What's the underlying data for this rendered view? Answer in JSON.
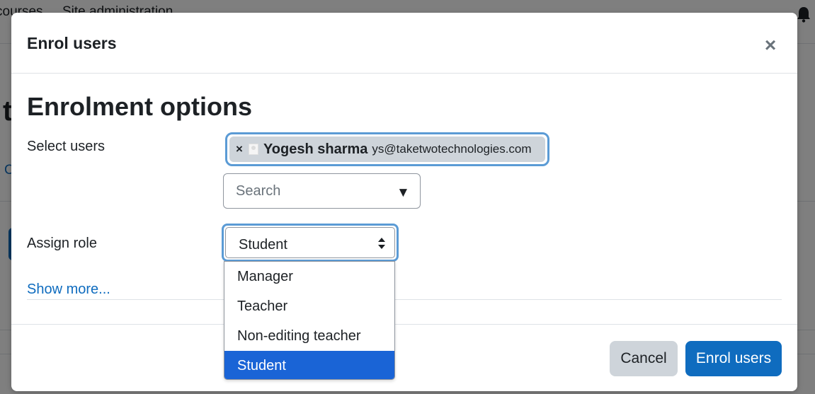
{
  "background_page": {
    "nav_courses_fragment": "courses",
    "nav_site_admin": "Site administration",
    "heading_fragment": "t",
    "link_fragment": "C"
  },
  "modal": {
    "title": "Enrol users",
    "close_glyph": "×",
    "section_heading": "Enrolment options",
    "select_users": {
      "label": "Select users",
      "selected_user": {
        "remove_glyph": "×",
        "name": "Yogesh sharma",
        "email": "ys@taketwotechnologies.com"
      },
      "search_placeholder": "Search",
      "search_caret": "▼"
    },
    "assign_role": {
      "label": "Assign role",
      "selected_value": "Student",
      "options": [
        "Manager",
        "Teacher",
        "Non-editing teacher",
        "Student"
      ],
      "highlighted_option": "Student"
    },
    "show_more_link": "Show more...",
    "buttons": {
      "cancel": "Cancel",
      "enrol": "Enrol users"
    }
  },
  "colors": {
    "primary": "#0f6cbf",
    "focus_ring": "#5b9bd5",
    "secondary_button": "#ced4da",
    "option_highlight": "#1a64d6",
    "backdrop": "rgba(0,0,0,0.5)"
  }
}
